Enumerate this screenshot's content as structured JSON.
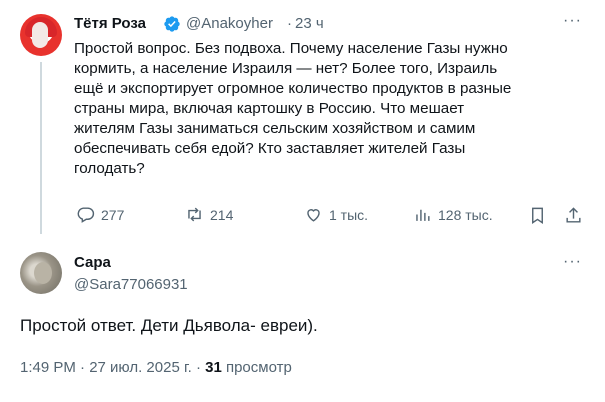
{
  "tweet": {
    "author_name": "Тётя Роза",
    "author_handle": "@Anakoyher",
    "separator": "·",
    "time_ago": "23 ч",
    "more": "···",
    "text_lines": [
      "Простой вопрос. Без подвоха. Почему население Газы нужно",
      "кормить, а население Израиля — нет? Более того, Израиль",
      "ещё и экспортирует огромное количество продуктов в разные",
      "страны мира, включая картошку в Россию. Что мешает",
      "жителям Газы заниматься сельским хозяйством и самим",
      "обеспечивать себя едой? Кто заставляет жителей Газы",
      "голодать?"
    ],
    "actions": {
      "replies": "277",
      "reposts": "214",
      "likes": "1 тыс.",
      "views": "128 тыс."
    }
  },
  "reply": {
    "author_name": "Сара",
    "author_handle": "@Sara77066931",
    "more": "···",
    "text": "Простой ответ. Дети Дьявола- евреи).",
    "timestamp": "1:49 PM · 27 июл. 2025 г. · ",
    "view_count": "31",
    "view_label": " просмотр"
  },
  "colors": {
    "text_primary": "#0f1419",
    "text_secondary": "#536471",
    "verified_blue": "#1d9bf0",
    "thread_line": "#cfd9de"
  }
}
